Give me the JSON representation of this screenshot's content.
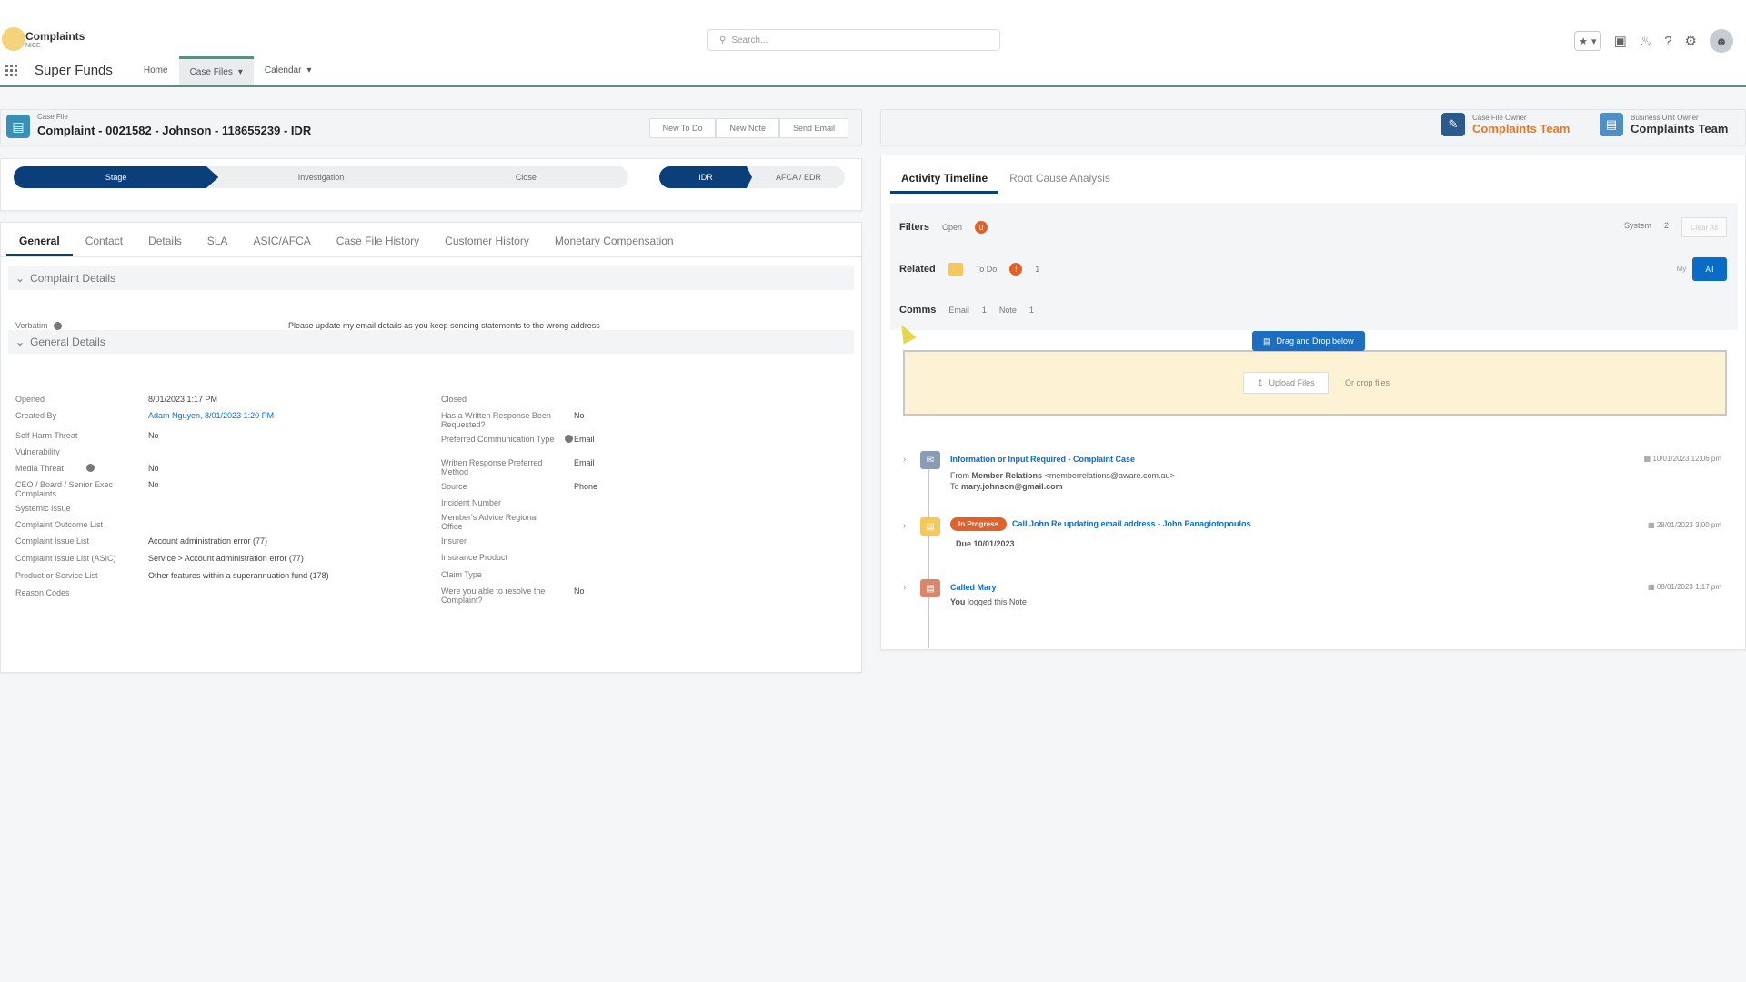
{
  "app": {
    "logo_title": "Complaints",
    "logo_sub": "NICE",
    "search_placeholder": "Search...",
    "name": "Super Funds",
    "nav": [
      {
        "label": "Home"
      },
      {
        "label": "Case Files"
      },
      {
        "label": "Calendar"
      }
    ]
  },
  "record": {
    "type": "Case File",
    "title": "Complaint - 0021582 - Johnson - 118655239 - IDR",
    "buttons": [
      "New To Do",
      "New Note",
      "Send Email"
    ]
  },
  "path": {
    "stages": [
      "Stage",
      "Investigation",
      "Close"
    ],
    "secondary": [
      "IDR",
      "AFCA / EDR"
    ]
  },
  "tabs": [
    "General",
    "Contact",
    "Details",
    "SLA",
    "ASIC/AFCA",
    "Case File History",
    "Customer History",
    "Monetary Compensation"
  ],
  "sections": {
    "complaint_details": "Complaint Details",
    "general_details": "General Details"
  },
  "complaint_details": {
    "verbatim_label": "Verbatim",
    "verbatim_value": "Please update my email details as you keep sending statements to the wrong address"
  },
  "general_left": [
    {
      "label": "Opened",
      "value": "8/01/2023 1:17 PM"
    },
    {
      "label": "Created By",
      "value": "Adam Nguyen, 8/01/2023 1:20 PM"
    },
    {
      "label": "Self Harm Threat",
      "value": "No"
    },
    {
      "label": "Vulnerability",
      "value": ""
    },
    {
      "label": "Media Threat",
      "value": "No"
    },
    {
      "label": "CEO / Board / Senior Exec Complaints",
      "value": "No"
    },
    {
      "label": "Systemic Issue",
      "value": ""
    },
    {
      "label": "Complaint Outcome List",
      "value": ""
    },
    {
      "label": "Complaint Issue List",
      "value": "Account administration error (77)"
    },
    {
      "label": "Complaint Issue List (ASIC)",
      "value": "Service > Account administration error (77)"
    },
    {
      "label": "Product or Service List",
      "value": "Other features within a superannuation fund (178)"
    },
    {
      "label": "Reason Codes",
      "value": ""
    }
  ],
  "general_right": [
    {
      "label": "Closed",
      "value": ""
    },
    {
      "label": "Has a Written Response Been Requested?",
      "value": "No"
    },
    {
      "label": "Preferred Communication Type",
      "value": "Email"
    },
    {
      "label": "Written Response Preferred Method",
      "value": "Email"
    },
    {
      "label": "Source",
      "value": "Phone"
    },
    {
      "label": "Incident Number",
      "value": ""
    },
    {
      "label": "Member's Advice Regional Office",
      "value": ""
    },
    {
      "label": "Insurer",
      "value": ""
    },
    {
      "label": "Insurance Product",
      "value": ""
    },
    {
      "label": "Claim Type",
      "value": ""
    },
    {
      "label": "Were you able to resolve the Complaint?",
      "value": "No"
    }
  ],
  "owners": [
    {
      "label": "Case File Owner",
      "value": "Complaints Team"
    },
    {
      "label": "Business Unit Owner",
      "value": "Complaints Team"
    }
  ],
  "activity": {
    "tabs": [
      "Activity Timeline",
      "Root Cause Analysis"
    ],
    "filters": {
      "filters_label": "Filters",
      "open_label": "Open",
      "open_count": "0",
      "related_label": "Related",
      "todo_label": "To Do",
      "todo_count": "1",
      "comms_label": "Comms",
      "email_label": "Email",
      "email_count": "1",
      "note_label": "Note",
      "note_count": "1",
      "system_label": "System",
      "system_count": "2",
      "clear_label": "Clear All",
      "my_label": "My",
      "all_label": "All"
    },
    "drop_tag": "Drag and Drop below",
    "upload_label": "Upload Files",
    "drop_text": "Or drop files",
    "items": [
      {
        "title": "Information or Input Required - Complaint Case",
        "line1_prefix": "From",
        "line1_bold": "Member Relations",
        "line1_rest": "<memberrelations@aware.com.au>",
        "line2_prefix": "To",
        "line2_bold": "mary.johnson@gmail.com",
        "date": "10/01/2023 12:06 pm"
      },
      {
        "pill": "In Progress",
        "title": "Call John Re updating email address - John Panagiotopoulos",
        "line1_bold": "Due 10/01/2023",
        "date": "28/01/2023 3:00 pm"
      },
      {
        "title": "Called Mary",
        "line1_bold": "You",
        "line1_rest": "logged this Note",
        "date": "08/01/2023 1:17 pm"
      }
    ]
  },
  "colors": {
    "accent": "#0a3f7a",
    "link": "#0a6cc7",
    "orange": "#e0612a"
  }
}
